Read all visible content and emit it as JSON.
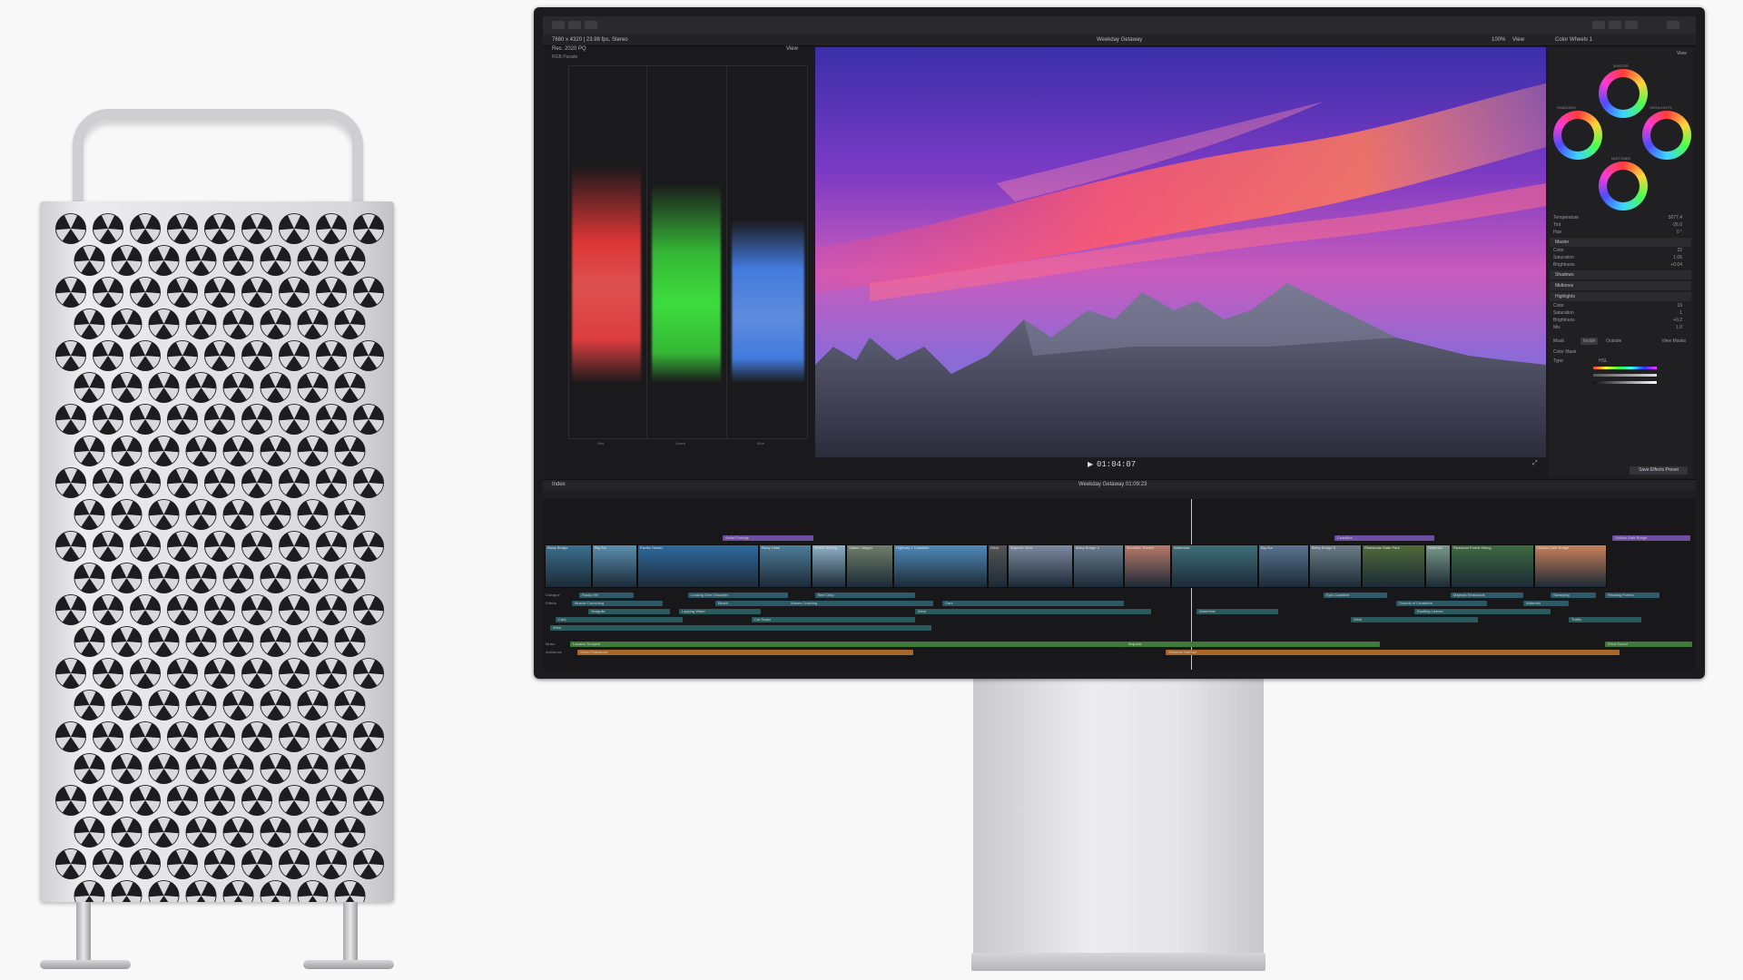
{
  "app": {
    "toolbar_left": "7680 x 4320 | 23.98 fps, Stereo",
    "library_label": "Rec. 2020 PQ",
    "view_label": "View",
    "project_title": "Weekday Getaway",
    "zoom": "100%",
    "viewer_view": "View",
    "right_header": "Color Wheels 1"
  },
  "scopes": {
    "title": "RGB Parade",
    "labels": [
      "Red",
      "Green",
      "Blue"
    ]
  },
  "viewer": {
    "timecode": "01:04:07"
  },
  "inspector": {
    "view": "View",
    "wheels": [
      "MASTER",
      "SHADOWS",
      "HIGHLIGHTS",
      "MIDTONES"
    ],
    "rows": [
      {
        "label": "Temperature",
        "value": "5077.4"
      },
      {
        "label": "Tint",
        "value": "-26.0"
      },
      {
        "label": "Hue",
        "value": "0 °"
      }
    ],
    "sections": [
      "Master",
      "Shadows",
      "Midtones",
      "Highlights"
    ],
    "master_rows": [
      "Color",
      "Saturation",
      "Brightness"
    ],
    "master_values": [
      "22",
      "1.06",
      "+0.04"
    ],
    "highlight_rows": [
      "Color",
      "Saturation",
      "Brightness",
      "Mix"
    ],
    "highlight_values": [
      "19",
      "1",
      "+0.2",
      "1.0"
    ],
    "mask_label": "Mask",
    "inside": "Inside",
    "outside": "Outside",
    "view_masks": "View Masks",
    "color_mask": "Color Mask",
    "type_label": "Type",
    "hsl_label": "HSL",
    "save_preset": "Save Effects Preset"
  },
  "timeline": {
    "index": "Index",
    "project": "Weekday Getaway",
    "duration": "01:09:23",
    "clips": [
      "Bixby Bridge",
      "Big Sur",
      "Pacific Ocean",
      "Bixby Hotel",
      "Beach Surfing",
      "Station Wagon",
      "Highway 1 Coastline",
      "Drive",
      "Majestic View",
      "Bixby Bridge 2",
      "Mountain Sunset",
      "Waterfalls",
      "Big Sur",
      "Bixby Bridge 3",
      "Redwoods State Park",
      "Waterfall",
      "Redwood Forest Hiking",
      "Golden Gate Bridge"
    ],
    "titles": [
      "Aerial Footage",
      "Coastline",
      "Golden Gate Bridge"
    ],
    "lanes": [
      "Dialogue",
      "Effects",
      "Music",
      "Ambience"
    ],
    "bars_top": [
      "Rocky Hill",
      "Looking Over Shoulder",
      "Bird Chirp",
      "Epic Coastline",
      "Majestic Redwoods",
      "Sweeping",
      "Reading Poems"
    ],
    "bars_mid": [
      "Muscle Crunching",
      "Beach",
      "Waves Crashing",
      "Cars",
      "Sounds of Creatures",
      "Waterfall"
    ],
    "bars_low": [
      "Seagulls",
      "Lapping Water",
      "Wind",
      "Waterfalls",
      "Rustling Leaves"
    ],
    "bars_low2": [
      "Cars",
      "Car Radio",
      "Wind",
      "Traffic"
    ],
    "bars_low3": [
      "Wind"
    ],
    "music_bars": [
      "Lazarus Tempest",
      "Majestic",
      "Wind Sound"
    ],
    "ambience_bars": [
      "Sonic Endeavors",
      "Shimmer Harmon"
    ]
  }
}
